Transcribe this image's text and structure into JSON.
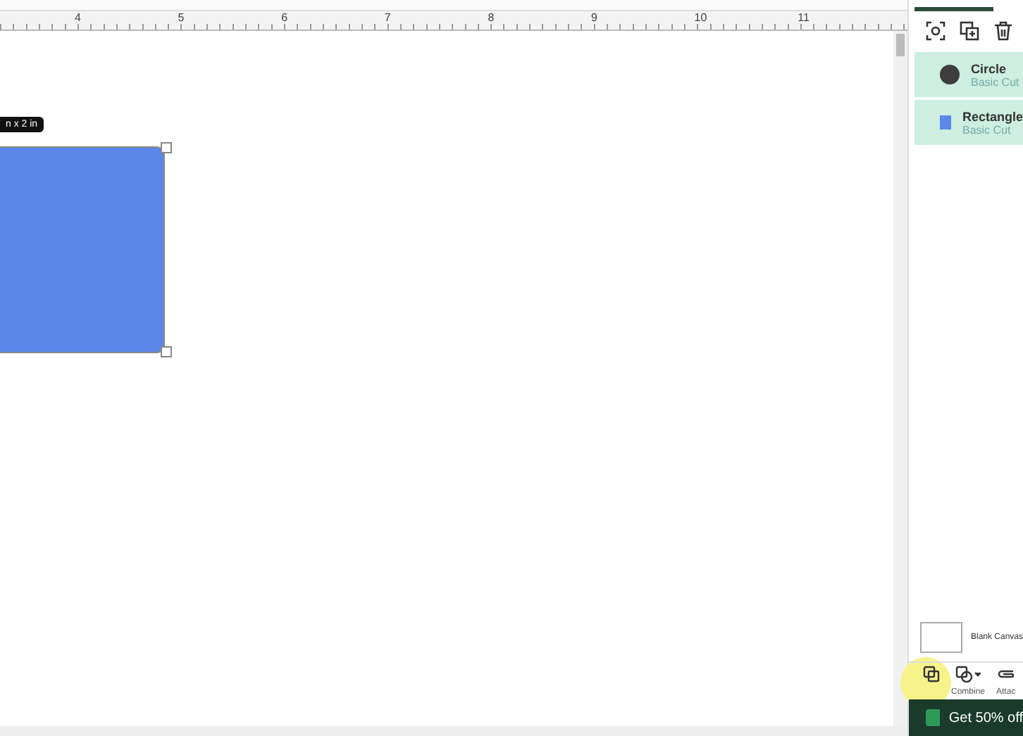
{
  "ruler": {
    "labels": [
      "4",
      "5",
      "6",
      "7",
      "8",
      "9",
      "10",
      "11"
    ]
  },
  "canvas": {
    "shape": {
      "dimension_label": "n x 2 in",
      "color": "#5b87ea"
    }
  },
  "layers": [
    {
      "name": "Circle",
      "operation": "Basic Cut",
      "kind": "circle",
      "color": "#3d3d3d",
      "selected": true
    },
    {
      "name": "Rectangle",
      "operation": "Basic Cut",
      "kind": "rect",
      "color": "#5b87ea",
      "selected": true
    }
  ],
  "canvas_item": {
    "label": "Blank Canvas"
  },
  "actions": [
    {
      "kind": "slice"
    },
    {
      "label": "Combine",
      "kind": "combine"
    },
    {
      "label": "Attac",
      "kind": "attach"
    }
  ],
  "banner": {
    "text": "Get 50% off"
  }
}
